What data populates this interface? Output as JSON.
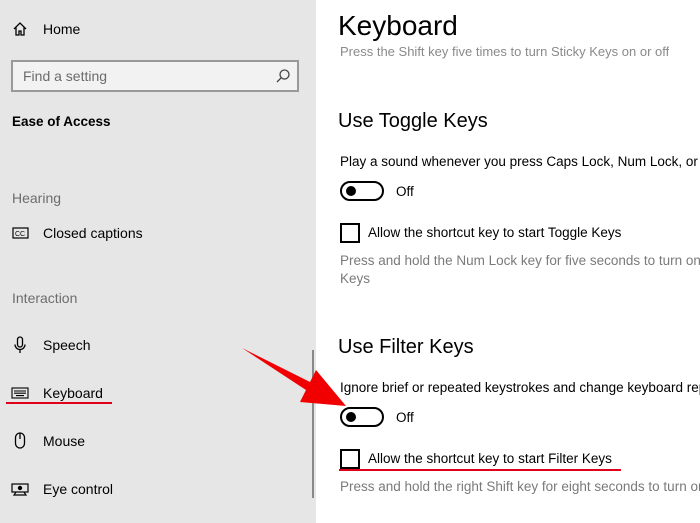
{
  "sidebar": {
    "home_label": "Home",
    "search_placeholder": "Find a setting",
    "section_title": "Ease of Access",
    "groups": {
      "hearing": "Hearing",
      "interaction": "Interaction"
    },
    "items": {
      "closed_captions": "Closed captions",
      "speech": "Speech",
      "keyboard": "Keyboard",
      "mouse": "Mouse",
      "eye_control": "Eye control"
    },
    "active_item": "Keyboard"
  },
  "main": {
    "title": "Keyboard",
    "sticky_keys_hint": "Press the Shift key five times to turn Sticky Keys on or off",
    "toggle_keys": {
      "heading": "Use Toggle Keys",
      "description": "Play a sound whenever you press Caps Lock, Num Lock, or Scroll Lock",
      "toggle_state": "Off",
      "shortcut_label": "Allow the shortcut key to start Toggle Keys",
      "shortcut_checked": false,
      "hint_line1": "Press and hold the Num Lock key for five seconds to turn on Toggle",
      "hint_line2": "Keys"
    },
    "filter_keys": {
      "heading": "Use Filter Keys",
      "description": "Ignore brief or repeated keystrokes and change keyboard repeat rates",
      "toggle_state": "Off",
      "shortcut_label": "Allow the shortcut key to start Filter Keys",
      "shortcut_checked": false,
      "hint": "Press and hold the right Shift key for eight seconds to turn on Filter Keys"
    }
  },
  "colors": {
    "sidebar_bg": "#e6e6e6",
    "annotation_red": "#e0001a",
    "hint_gray": "#7a7a7a"
  },
  "icons": {
    "home": "home-icon",
    "search": "search-icon",
    "closed_captions": "closed-captions-icon",
    "speech": "microphone-icon",
    "keyboard": "keyboard-icon",
    "mouse": "mouse-icon",
    "eye_control": "eye-control-icon"
  }
}
